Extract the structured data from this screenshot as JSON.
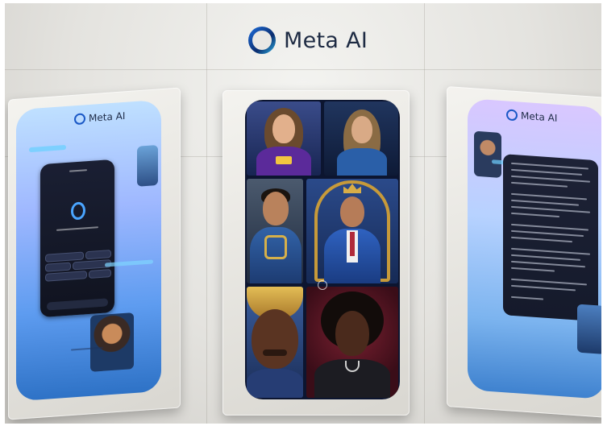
{
  "brand": {
    "name": "Meta AI",
    "mini_name": "Meta AI"
  },
  "colors": {
    "brand_ring_start": "#1d6fe0",
    "brand_ring_end": "#0b2d6e",
    "screen_blue": "#5e9cf0",
    "text_dark": "#1e2b43"
  },
  "panels": {
    "left": {
      "kind": "chat-start-screen"
    },
    "center": {
      "kind": "generated-portrait-grid",
      "tiles": 6
    },
    "right": {
      "kind": "chat-response-screen"
    }
  }
}
